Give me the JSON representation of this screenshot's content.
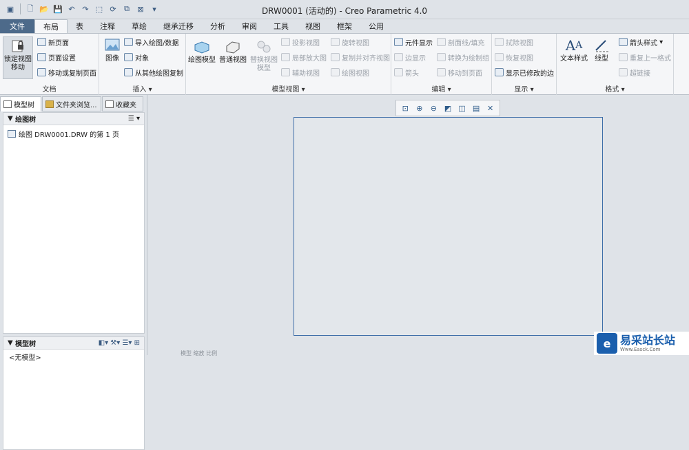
{
  "window": {
    "title": "DRW0001 (活动的) - Creo Parametric 4.0"
  },
  "qat": {
    "icons": [
      "app-icon",
      "new-icon",
      "open-icon",
      "save-icon",
      "undo-icon",
      "redo-icon",
      "select-box-icon",
      "regenerate-icon",
      "windows-icon",
      "close-icon",
      "customize-icon"
    ]
  },
  "tabs": [
    "文件",
    "布局",
    "表",
    "注释",
    "草绘",
    "继承迁移",
    "分析",
    "审阅",
    "工具",
    "视图",
    "框架",
    "公用"
  ],
  "active_tab": "布局",
  "ribbon": {
    "document": {
      "label": "文档",
      "lock_view": "锁定视图\n移动",
      "new_page": "新页面",
      "page_setup": "页面设置",
      "move_copy_page": "移动或复制页面"
    },
    "insert": {
      "label": "插入",
      "image": "图像",
      "import": "导入绘图/数据",
      "object": "对象",
      "copy_from_other": "从其他绘图复制"
    },
    "model_views": {
      "label": "模型视图",
      "drawing_model": "绘图模型",
      "general_view": "普通视图",
      "replace_model": "替换视图\n模型",
      "projection_view": "投影视图",
      "detail_view": "局部放大图",
      "auxiliary_view": "辅助视图",
      "revolved_view": "旋转视图",
      "copy_align_view": "复制并对齐视图",
      "drawing_view": "绘图视图"
    },
    "edit": {
      "label": "编辑",
      "component_display": "元件显示",
      "edge_display": "边显示",
      "arrow": "箭头",
      "section_hatch": "剖面线/填充",
      "convert_to_drawing": "转换为绘制组",
      "move_to_page": "移动到页面"
    },
    "display": {
      "label": "显示",
      "erase_view": "拭除视图",
      "resume_view": "恢复视图",
      "show_modified_edges": "显示已修改的边"
    },
    "format": {
      "label": "格式",
      "text_style": "文本样式",
      "line_style": "线型",
      "arrow_style": "箭头样式",
      "repeat_last_format": "重复上一格式",
      "hyperlink": "超链接"
    }
  },
  "panel": {
    "tabs": [
      "模型树",
      "文件夹浏览...",
      "收藏夹"
    ],
    "drawing_tree_header": "绘图树",
    "drawing_tree_item": "绘图 DRW0001.DRW 的第 1 页",
    "model_tree_header": "模型树",
    "model_tree_item": "<无模型>"
  },
  "view_toolbar": {
    "icons": [
      "refit-icon",
      "zoom-in-icon",
      "zoom-out-icon",
      "repaint-icon",
      "display-style-icon",
      "view-manager-icon",
      "annotation-display-icon"
    ]
  },
  "status": "模型 缩放 比例",
  "watermark": {
    "title": "易采站长站",
    "url": "Www.Easck.Com"
  },
  "colors": {
    "file_tab": "#4d6a8a",
    "sheet_border": "#3e6ea8",
    "background": "#dfe3e8",
    "ribbon": "#f5f6f8"
  }
}
